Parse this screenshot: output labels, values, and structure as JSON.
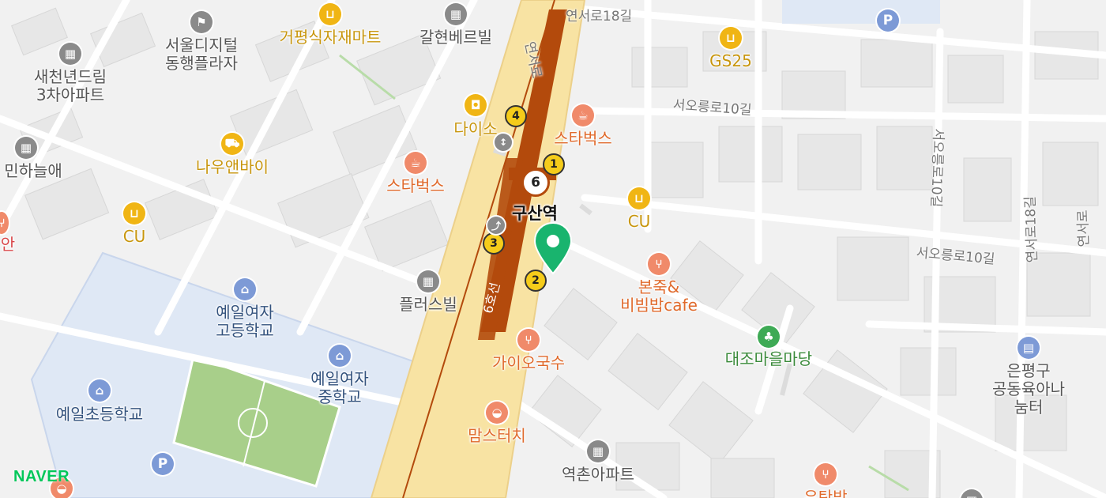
{
  "brand": {
    "logo_text": "NAVER"
  },
  "colors": {
    "brand_green": "#03c75a",
    "subway_line_6": "#b34a0c",
    "main_road": "#f8e3a3",
    "school_area": "#dfe8f5",
    "sports_field": "#a8cf8a",
    "pin": "#19b46e"
  },
  "station": {
    "name": "구산역",
    "line_badge": "6",
    "exits": [
      "1",
      "2",
      "3",
      "4"
    ],
    "line_label": "6호선"
  },
  "selected_location": {
    "icon": "map-pin-icon"
  },
  "roads": {
    "yeonseoro": "연서로",
    "yeonseoro_18gil_top": "연서로18길",
    "seooreungro_10gil_upper": "서오릉로10길",
    "seooreungro_10gil_lower": "서오릉로10길",
    "seooreungro_10gil_vertical": "서오릉로10길",
    "yeonseoro_18gil_vertical": "연서로18길",
    "partial_right": "연서로"
  },
  "places": {
    "seoul_digital": {
      "name": "서울디지털\n동행플라자",
      "icon": "flag-icon"
    },
    "geopyeong": {
      "name": "거평식자재마트",
      "icon": "basket-icon"
    },
    "galhyeon": {
      "name": "갈현베르빌",
      "icon": "building-icon"
    },
    "saecheonnyeon": {
      "name": "새천년드림\n3차아파트",
      "icon": "building-icon"
    },
    "minhaneulae": {
      "name": "민하늘애",
      "icon": "building-icon"
    },
    "daiso": {
      "name": "다이소",
      "icon": "bag-icon"
    },
    "starbucks_right": {
      "name": "스타벅스",
      "icon": "cup-icon"
    },
    "starbucks_left": {
      "name": "스타벅스",
      "icon": "cup-icon"
    },
    "nauandbuy": {
      "name": "나우앤바이",
      "icon": "cart-icon"
    },
    "cu_left": {
      "name": "CU",
      "icon": "basket-icon"
    },
    "cu_right": {
      "name": "CU",
      "icon": "basket-icon"
    },
    "gs25": {
      "name": "GS25",
      "icon": "basket-icon"
    },
    "bonjuk": {
      "name": "본죽&\n비빔밥cafe",
      "icon": "fork-knife-icon"
    },
    "daejo_madang": {
      "name": "대조마을마당",
      "icon": "tree-icon"
    },
    "plusville": {
      "name": "플러스빌",
      "icon": "building-icon"
    },
    "yeil_high": {
      "name": "예일여자\n고등학교",
      "icon": "school-icon"
    },
    "yeil_middle": {
      "name": "예일여자\n중학교",
      "icon": "school-icon"
    },
    "yeil_elem": {
      "name": "예일초등학교",
      "icon": "school-icon"
    },
    "gaio": {
      "name": "가이오국수",
      "icon": "fork-knife-icon"
    },
    "momstouch": {
      "name": "맘스터치",
      "icon": "burger-icon"
    },
    "eunpyeong": {
      "name": "은평구\n공동육아나눔터",
      "icon": "library-icon"
    },
    "yeokchon": {
      "name": "역촌아파트",
      "icon": "building-icon"
    },
    "partial_left": {
      "name": "안"
    },
    "partial_bottom": {
      "name": "유탄방"
    }
  },
  "parking": {
    "symbol": "P"
  }
}
